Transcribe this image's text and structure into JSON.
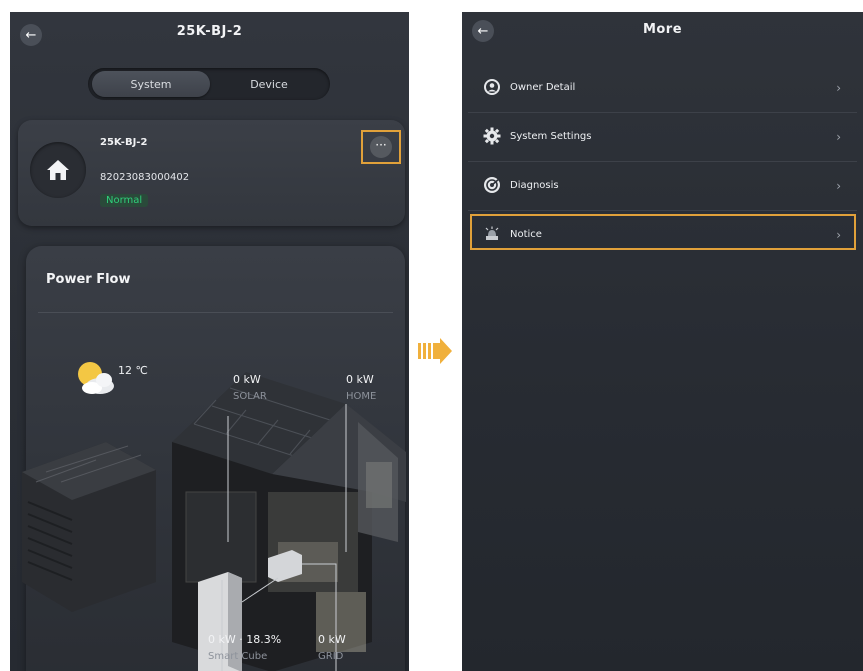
{
  "left": {
    "header": {
      "title": "25K-BJ-2"
    },
    "tabs": [
      {
        "label": "System",
        "active": true
      },
      {
        "label": "Device",
        "active": false
      }
    ],
    "station": {
      "name": "25K-BJ-2",
      "serial": "82023083000402",
      "status": "Normal",
      "more_label": "···"
    },
    "power_flow": {
      "title": "Power Flow",
      "weather": {
        "icon": "partly-cloudy-icon",
        "temperature": "12 ℃"
      },
      "solar": {
        "value": "0 kW",
        "label": "SOLAR"
      },
      "home": {
        "value": "0 kW",
        "label": "HOME"
      },
      "battery": {
        "value": "0 kW · 18.3%",
        "label": "Smart Cube"
      },
      "grid": {
        "value": "0 kW",
        "label": "GRID"
      }
    }
  },
  "right": {
    "header": {
      "title": "More"
    },
    "menu": [
      {
        "label": "Owner Detail",
        "icon": "user-circle-icon"
      },
      {
        "label": "System Settings",
        "icon": "gear-icon"
      },
      {
        "label": "Diagnosis",
        "icon": "diagnosis-icon"
      },
      {
        "label": "Notice",
        "icon": "notice-icon"
      }
    ]
  },
  "colors": {
    "accent_highlight": "#e1a13a",
    "status_green": "#2fd07a",
    "background_dark": "#2b2f36"
  }
}
